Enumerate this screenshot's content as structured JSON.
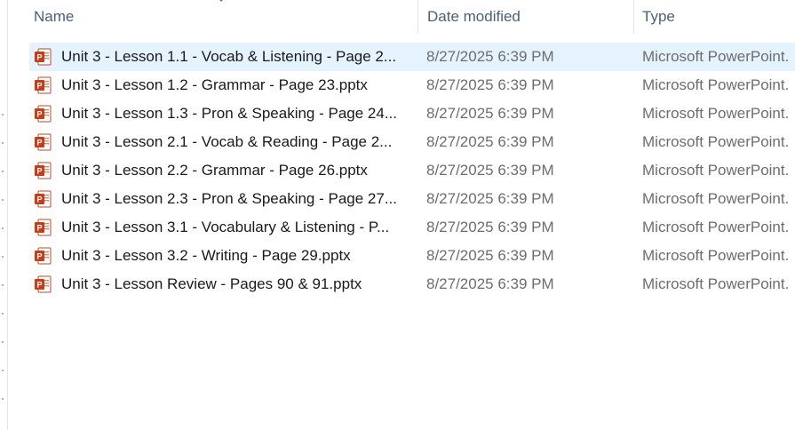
{
  "columns": {
    "name": "Name",
    "date_modified": "Date modified",
    "type": "Type"
  },
  "icons": {
    "file": "powerpoint-file-icon",
    "sort": "sort-chevron-icon"
  },
  "colors": {
    "selected_row": "#e5f3ff",
    "powerpoint_orange": "#c43e1c",
    "header_text": "#4c607a"
  },
  "files": [
    {
      "name": "Unit 3 - Lesson 1.1 - Vocab & Listening - Page 2...",
      "date": "8/27/2025 6:39 PM",
      "type": "Microsoft PowerPoint.",
      "selected": true
    },
    {
      "name": "Unit 3 - Lesson 1.2 - Grammar - Page 23.pptx",
      "date": "8/27/2025 6:39 PM",
      "type": "Microsoft PowerPoint."
    },
    {
      "name": "Unit 3 - Lesson 1.3 - Pron & Speaking - Page 24...",
      "date": "8/27/2025 6:39 PM",
      "type": "Microsoft PowerPoint."
    },
    {
      "name": "Unit 3 - Lesson 2.1 - Vocab & Reading - Page 2...",
      "date": "8/27/2025 6:39 PM",
      "type": "Microsoft PowerPoint."
    },
    {
      "name": "Unit 3 - Lesson 2.2 - Grammar - Page 26.pptx",
      "date": "8/27/2025 6:39 PM",
      "type": "Microsoft PowerPoint."
    },
    {
      "name": "Unit 3 - Lesson 2.3 - Pron & Speaking - Page 27...",
      "date": "8/27/2025 6:39 PM",
      "type": "Microsoft PowerPoint."
    },
    {
      "name": "Unit 3 - Lesson 3.1 - Vocabulary &  Listening - P...",
      "date": "8/27/2025 6:39 PM",
      "type": "Microsoft PowerPoint."
    },
    {
      "name": "Unit 3 - Lesson 3.2 - Writing - Page 29.pptx",
      "date": "8/27/2025 6:39 PM",
      "type": "Microsoft PowerPoint."
    },
    {
      "name": "Unit 3 - Lesson Review - Pages 90 & 91.pptx",
      "date": "8/27/2025 6:39 PM",
      "type": "Microsoft PowerPoint."
    }
  ]
}
